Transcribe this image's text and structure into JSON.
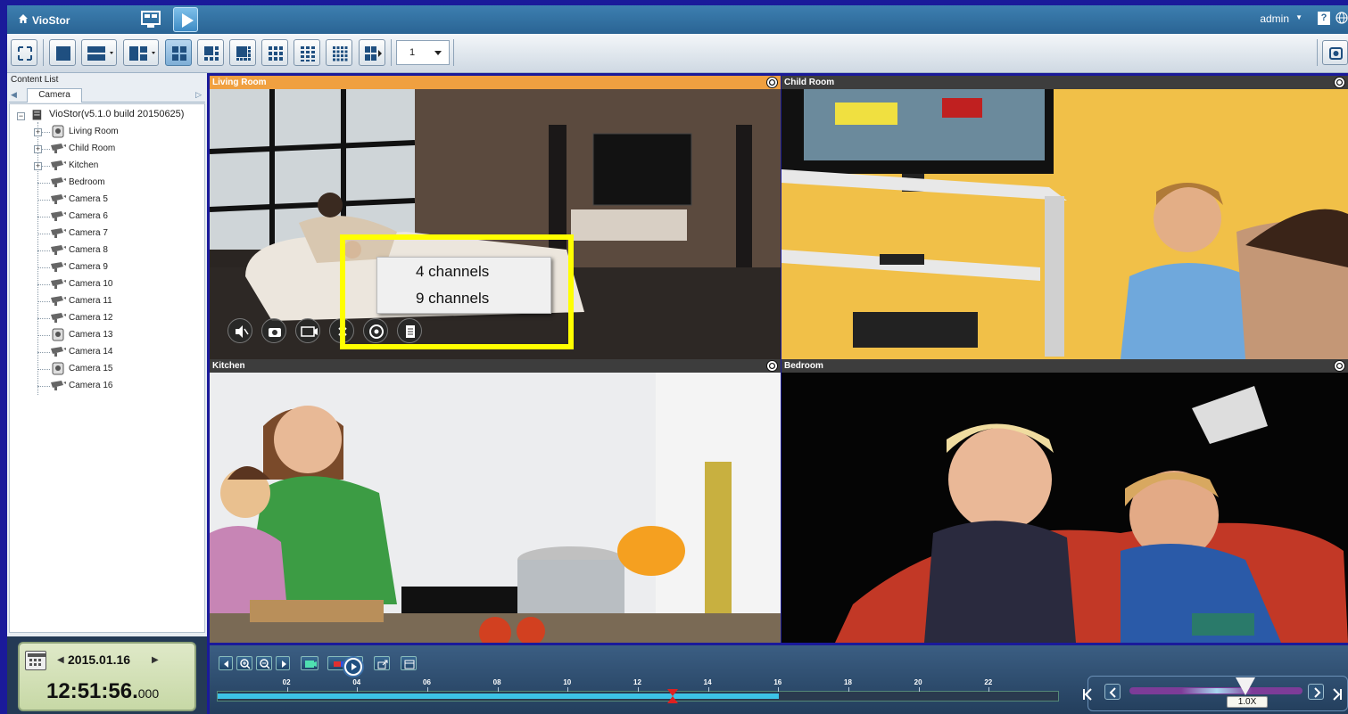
{
  "app": {
    "title": "VioStor",
    "user": "admin"
  },
  "toolbar": {
    "page_select_value": "1"
  },
  "sidebar": {
    "content_list_label": "Content List",
    "tab_label": "Camera",
    "server": "VioStor(v5.1.0 build 20150625)",
    "cameras": [
      {
        "label": "Living Room",
        "expandable": true,
        "ptz": true
      },
      {
        "label": "Child Room",
        "expandable": true,
        "ptz": false
      },
      {
        "label": "Kitchen",
        "expandable": true,
        "ptz": false
      },
      {
        "label": "Bedroom",
        "expandable": false,
        "ptz": false
      },
      {
        "label": "Camera 5",
        "expandable": false,
        "ptz": false
      },
      {
        "label": "Camera 6",
        "expandable": false,
        "ptz": false
      },
      {
        "label": "Camera 7",
        "expandable": false,
        "ptz": false
      },
      {
        "label": "Camera 8",
        "expandable": false,
        "ptz": false
      },
      {
        "label": "Camera 9",
        "expandable": false,
        "ptz": false
      },
      {
        "label": "Camera 10",
        "expandable": false,
        "ptz": false
      },
      {
        "label": "Camera 11",
        "expandable": false,
        "ptz": false
      },
      {
        "label": "Camera 12",
        "expandable": false,
        "ptz": false
      },
      {
        "label": "Camera 13",
        "expandable": false,
        "ptz": true
      },
      {
        "label": "Camera 14",
        "expandable": false,
        "ptz": false
      },
      {
        "label": "Camera 15",
        "expandable": false,
        "ptz": true
      },
      {
        "label": "Camera 16",
        "expandable": false,
        "ptz": false
      }
    ]
  },
  "video": {
    "cells": [
      {
        "title": "Living Room",
        "active": true
      },
      {
        "title": "Child Room",
        "active": false
      },
      {
        "title": "Kitchen",
        "active": false
      },
      {
        "title": "Bedroom",
        "active": false
      }
    ],
    "popup": {
      "items": [
        "4 channels",
        "9 channels"
      ]
    }
  },
  "playback": {
    "date": "2015.01.16",
    "time": "12:51:56.",
    "time_ms": "000",
    "hour_labels": [
      "02",
      "04",
      "06",
      "08",
      "10",
      "12",
      "14",
      "16",
      "18",
      "20",
      "22"
    ],
    "recorded_until_hour": 16,
    "cursor_hour": 13,
    "speed": "1.0X"
  },
  "colors": {
    "accent": "#f0a040",
    "highlight": "#ffff00",
    "track_fill": "#3cc3e6",
    "desktop": "#1a1a9a"
  }
}
